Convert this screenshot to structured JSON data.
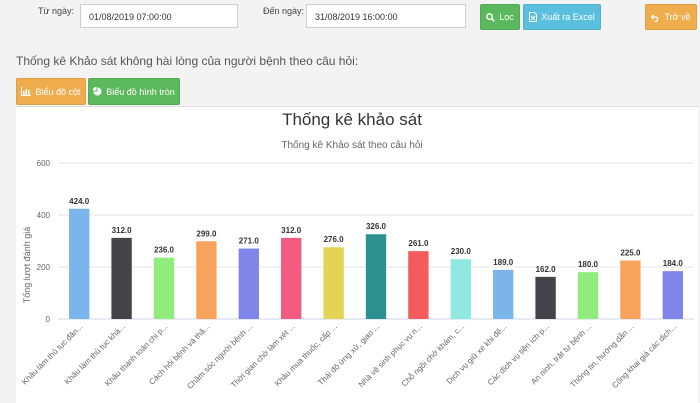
{
  "filters": {
    "from_label": "Từ ngày:",
    "from_value": "01/08/2019 07:00:00",
    "to_label": "Đến ngày:",
    "to_value": "31/08/2019 16:00:00"
  },
  "buttons": {
    "filter": "Lọc",
    "export": "Xuất ra Excel",
    "back": "Trở về",
    "bar_chart": "Biểu đồ cột",
    "pie_chart": "Biểu đồ hình tròn"
  },
  "section_title": "Thống kê Khảo sát không hài lòng của người bệnh theo câu hỏi:",
  "colors": {
    "filter_button": "#5cb85c",
    "export_button": "#5bc0de",
    "back_button": "#f0ad4e",
    "bar_chart_button": "#f0ad4e",
    "pie_chart_button": "#5cb85c"
  },
  "icons": {
    "filter": "search-icon",
    "export": "file-excel-icon",
    "back": "undo-icon",
    "bar_chart": "bar-chart-icon",
    "pie_chart": "pie-chart-icon"
  },
  "chart_data": {
    "type": "bar",
    "title": "Thống kê khảo sát",
    "subtitle": "Thống kê Khảo sát theo câu hỏi",
    "ylabel": "Tổng lượt đánh giá",
    "xlabel": "",
    "ylim": [
      0,
      600
    ],
    "yticks": [
      0,
      200,
      400,
      600
    ],
    "grid": true,
    "categories": [
      "Khâu làm thủ tục đăn...",
      "Khâu làm thủ tục khá...",
      "Khâu thanh toán chi p...",
      "Cách hỏi bệnh và thă...",
      "Chăm sóc người bệnh ...",
      "Thời gian chờ làm xét ...",
      "Khâu mua thuốc, cấp ...",
      "Thái độ ứng xử, giao ...",
      "Nhà vệ sinh phục vụ n...",
      "Chỗ ngồi chờ khám, c...",
      "Dịch vụ giữ xe khi đế...",
      "Các dịch vụ tiện ích p...",
      "An ninh, trật tự bệnh ...",
      "Thông tin, hướng dẫn ...",
      "Công khai giá các dịch..."
    ],
    "values": [
      424.0,
      312.0,
      236.0,
      299.0,
      271.0,
      312.0,
      276.0,
      326.0,
      261.0,
      230.0,
      189.0,
      162.0,
      180.0,
      225.0,
      184.0
    ],
    "value_labels": [
      "424.0",
      "312.0",
      "236.0",
      "299.0",
      "271.0",
      "312.0",
      "276.0",
      "326.0",
      "261.0",
      "230.0",
      "189.0",
      "162.0",
      "180.0",
      "225.0",
      "184.0"
    ],
    "colors": [
      "#7cb5ec",
      "#434348",
      "#90ed7d",
      "#f7a35c",
      "#8085e9",
      "#f15c80",
      "#e4d354",
      "#2b908f",
      "#f45b5b",
      "#91e8e1",
      "#7cb5ec",
      "#434348",
      "#90ed7d",
      "#f7a35c",
      "#8085e9"
    ]
  }
}
